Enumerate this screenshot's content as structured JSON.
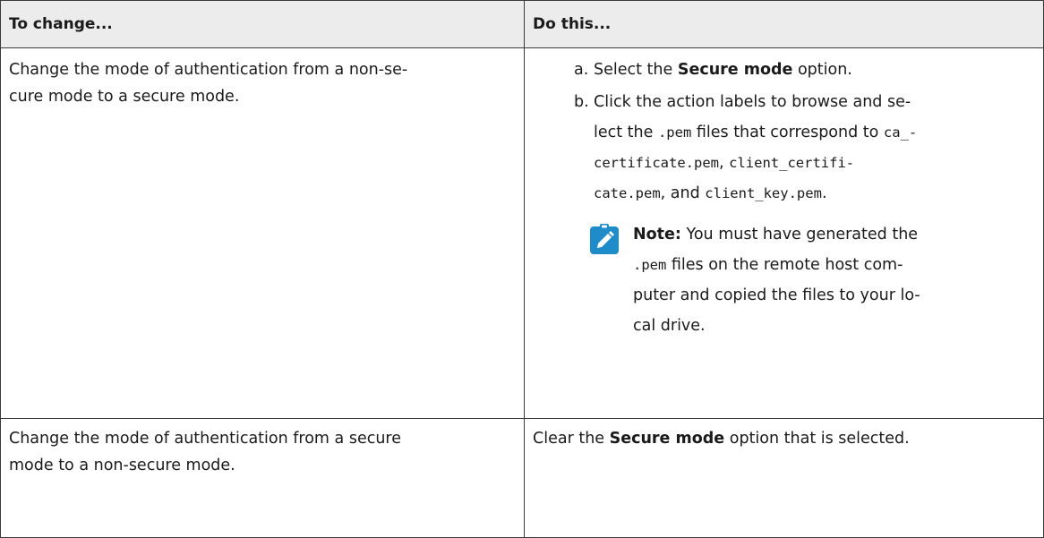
{
  "table": {
    "headers": [
      "To change...",
      "Do this..."
    ],
    "rows": [
      {
        "change_lines": [
          "Change the mode of authentication from a non-se-",
          "cure mode to a secure mode."
        ],
        "steps": [
          {
            "marker": "a.",
            "before": "Select the ",
            "bold": "Secure mode",
            "after": " option."
          },
          {
            "marker": "b.",
            "line1": "Click the action labels to browse and se-",
            "line2_pre": "lect the ",
            "line2_code1": ".pem",
            "line2_mid": " files that correspond to ",
            "line2_code2": "ca_-",
            "line3_code1": "certificate.pem",
            "line3_sep": ", ",
            "line3_code2": "client_certifi-",
            "line4_code1": "cate.pem",
            "line4_mid": ", and ",
            "line4_code2": "client_key.pem",
            "line4_end": "."
          }
        ],
        "note": {
          "icon": "pencil-note-icon",
          "label": "Note:",
          "line1": " You must have generated the",
          "line2_code": ".pem",
          "line2_text": " files on the remote host com-",
          "line3": "puter and copied the files to your lo-",
          "line4": "cal drive."
        }
      },
      {
        "change_lines": [
          "Change the mode of authentication from a secure",
          "mode to a non-secure mode."
        ],
        "do_before": "Clear the ",
        "do_bold": "Secure mode",
        "do_after": " option that is selected."
      }
    ]
  },
  "colors": {
    "border": "#3a3a3a",
    "header_bg": "#ececec",
    "icon": "#1f8bc9"
  }
}
